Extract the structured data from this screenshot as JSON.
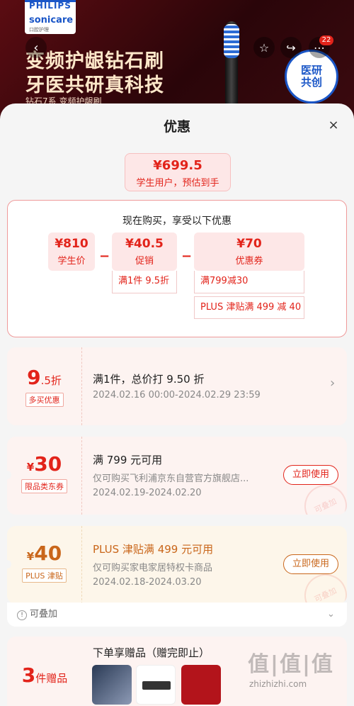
{
  "banner": {
    "brand_line1": "PHILIPS",
    "brand_line2": "sonicare",
    "brand_line3": "口腔护理",
    "headline1": "变频护龈钻石刷",
    "headline2": "牙医共研真科技",
    "series": "钻石7系 变频护龈刷",
    "seal_line1": "医研",
    "seal_line2": "共创",
    "cart_count": "22"
  },
  "icons": {
    "back": "chevron-left-icon",
    "favorite": "star-icon",
    "share": "share-icon",
    "more": "more-icon"
  },
  "sheet": {
    "title": "优惠",
    "close": "×",
    "total_price": "¥699.5",
    "total_label": "学生用户，预估到手",
    "calc_title": "现在购买，享受以下优惠",
    "base_price": "¥810",
    "base_label": "学生价",
    "promo_value": "¥40.5",
    "promo_label": "促销",
    "promo_note": "满1件 9.5折",
    "coupon_value": "¥70",
    "coupon_label": "优惠券",
    "coupon_note1": "满799减30",
    "coupon_note2": "PLUS 津贴满 499 减 40",
    "minus": "−"
  },
  "cards": [
    {
      "big": "9",
      "big_suffix": ".5折",
      "tag": "多买优惠",
      "title": "满1件，总价打 9.50 折",
      "date": "2024.02.16 00:00-2024.02.29 23:59"
    },
    {
      "currency": "¥",
      "big": "30",
      "tag": "限品类东券",
      "title": "满 799 元可用",
      "desc": "仅可购买飞利浦京东自营官方旗舰店...",
      "date": "2024.02.19-2024.02.20",
      "button": "立即使用",
      "stamp": "可叠加"
    },
    {
      "currency": "¥",
      "big": "40",
      "tag": "PLUS 津贴",
      "title": "PLUS 津贴满 499 元可用",
      "desc": "仅可购买家电家居特权卡商品",
      "date": "2024.02.18-2024.03.20",
      "button": "立即使用",
      "stamp": "可叠加"
    }
  ],
  "stack_label": "可叠加",
  "gift": {
    "big": "3",
    "unit": "件赠品",
    "title": "下单享赠品（赠完即止）"
  },
  "watermark": {
    "text": "值|值|值",
    "url": "zhizhizhi.com"
  },
  "colors": {
    "accent": "#e2231a",
    "gold": "#c9661a"
  }
}
